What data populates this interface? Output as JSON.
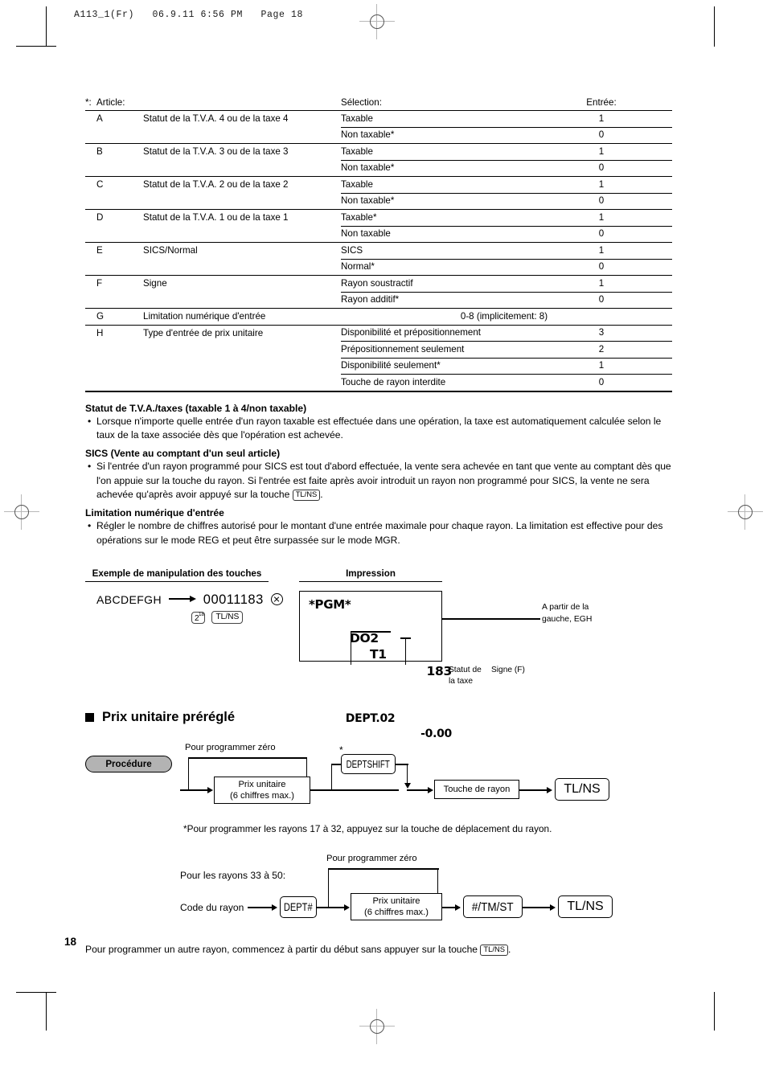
{
  "printer_slug": "A113_1(Fr)   06.9.11 6:56 PM   Page 18",
  "page_number": "18",
  "table": {
    "headers": {
      "star": "*:",
      "article": "Article:",
      "selection": "Sélection:",
      "entry": "Entrée:"
    },
    "rows": [
      {
        "letter": "A",
        "desc": "Statut de la T.V.A. 4 ou de la taxe 4",
        "options": [
          {
            "selection": "Taxable",
            "entry": "1"
          },
          {
            "selection": "Non taxable*",
            "entry": "0"
          }
        ]
      },
      {
        "letter": "B",
        "desc": "Statut de la T.V.A. 3 ou de la taxe 3",
        "options": [
          {
            "selection": "Taxable",
            "entry": "1"
          },
          {
            "selection": "Non taxable*",
            "entry": "0"
          }
        ]
      },
      {
        "letter": "C",
        "desc": "Statut de la T.V.A. 2 ou de la taxe 2",
        "options": [
          {
            "selection": "Taxable",
            "entry": "1"
          },
          {
            "selection": "Non taxable*",
            "entry": "0"
          }
        ]
      },
      {
        "letter": "D",
        "desc": "Statut de la T.V.A. 1 ou de la taxe 1",
        "options": [
          {
            "selection": "Taxable*",
            "entry": "1"
          },
          {
            "selection": "Non taxable",
            "entry": "0"
          }
        ]
      },
      {
        "letter": "E",
        "desc": "SICS/Normal",
        "options": [
          {
            "selection": "SICS",
            "entry": "1"
          },
          {
            "selection": "Normal*",
            "entry": "0"
          }
        ]
      },
      {
        "letter": "F",
        "desc": "Signe",
        "options": [
          {
            "selection": "Rayon soustractif",
            "entry": "1"
          },
          {
            "selection": "Rayon additif*",
            "entry": "0"
          }
        ]
      },
      {
        "letter": "G",
        "desc": "Limitation numérique d'entrée",
        "options": [
          {
            "selection": "",
            "entry": "0-8 (implicitement: 8)"
          }
        ]
      },
      {
        "letter": "H",
        "desc": "Type d'entrée de prix unitaire",
        "options": [
          {
            "selection": "Disponibilité et prépositionnement",
            "entry": "3"
          },
          {
            "selection": "Prépositionnement seulement",
            "entry": "2"
          },
          {
            "selection": "Disponibilité seulement*",
            "entry": "1"
          },
          {
            "selection": "Touche de rayon interdite",
            "entry": "0"
          }
        ]
      }
    ]
  },
  "prose": {
    "s1_title": "Statut de T.V.A./taxes (taxable 1 à 4/non taxable)",
    "s1_body": "Lorsque n'importe quelle entrée d'un rayon taxable est effectuée dans une opération, la taxe est automatiquement calculée selon le taux de la taxe associée dès que l'opération est achevée.",
    "s2_title": "SICS (Vente au comptant d'un seul article)",
    "s2_body_a": "Si l'entrée d'un rayon programmé pour SICS est tout d'abord effectuée, la vente sera achevée en tant que vente au comptant dès que l'on appuie sur la touche du rayon. Si l'entrée est faite après avoir introduit un rayon non programmé pour SICS, la vente ne sera achevée qu'après avoir appuyé sur la touche",
    "s2_chip": "TL/NS",
    "s2_body_b": ".",
    "s3_title": "Limitation numérique d'entrée",
    "s3_body": "Régler le nombre de chiffres autorisé pour le montant d'une entrée maximale pour chaque rayon. La limitation est effective pour des opérations sur le mode REG et peut être surpassée sur le mode MGR."
  },
  "example": {
    "heading_keys": "Exemple de manipulation des touches",
    "heading_print": "Impression",
    "sequence_label": "ABCDEFGH",
    "sequence_digits": "00011183",
    "multiply_icon": "circled-multiply-icon",
    "key_two_base": "2",
    "key_two_sup": "18",
    "key_tlns": "TL/NS",
    "receipt": {
      "line1": "*PGM*",
      "line2_left": "DO2",
      "line2_mid": "T1",
      "line2_right": "183",
      "line3_left": "DEPT.02",
      "line3_right": "-0.00"
    },
    "callout_right": "A partir de la\ngauche, EGH",
    "callout_tax": "Statut de\nla taxe",
    "callout_sign": "Signe (F)"
  },
  "section": {
    "title": "Prix unitaire préréglé",
    "bullet_icon": "filled-square-icon",
    "procedure_badge": "Procédure",
    "flow1": {
      "zero_label": "Pour programmer zéro",
      "price_box_l1": "Prix unitaire",
      "price_box_l2": "(6 chiffres max.)",
      "deptshift_key": "DEPTSHIFT",
      "deptshift_star": "*",
      "dept_key_box": "Touche de rayon",
      "tlns_key": "TL/NS"
    },
    "footnote": "*Pour programmer les rayons 17 à 32, appuyez sur la touche de déplacement du rayon.",
    "flow2_intro": "Pour les rayons 33 à 50:",
    "flow2": {
      "zero_label": "Pour programmer zéro",
      "code_label": "Code du rayon",
      "dept_hash_key": "DEPT#",
      "price_box_l1": "Prix unitaire",
      "price_box_l2": "(6 chiffres max.)",
      "tmst_key": "#/TM/ST",
      "tlns_key": "TL/NS"
    },
    "closing_a": "Pour programmer un autre rayon, commencez à partir du début sans appuyer sur la touche",
    "closing_chip": "TL/NS",
    "closing_b": "."
  },
  "colors": {
    "ink": "#000000",
    "badge_fill": "#b3b3b3",
    "regmark": "#b8b8b8"
  }
}
